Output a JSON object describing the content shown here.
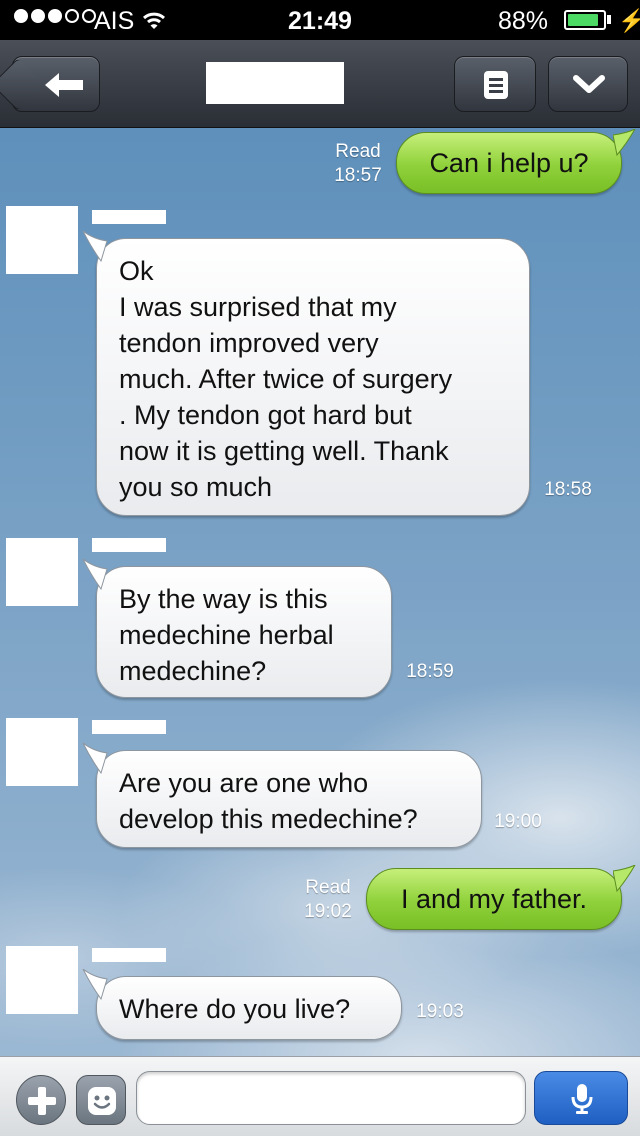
{
  "status_bar": {
    "carrier": "AIS",
    "time": "21:49",
    "battery_percent": "88%",
    "battery_level": 0.88,
    "signal_bars_filled": 3,
    "signal_bars_total": 5
  },
  "header": {
    "contact_name_redacted": true
  },
  "messages": [
    {
      "direction": "outgoing",
      "text": "Can i help u?",
      "status": "Read",
      "time": "18:57"
    },
    {
      "direction": "incoming",
      "text": "Ok\nI was surprised that my\ntendon improved very\nmuch. After twice of surgery\n. My tendon got hard but\nnow it is getting well. Thank\nyou so much",
      "time": "18:58"
    },
    {
      "direction": "incoming",
      "text": "By the way is this\nmedechine herbal\nmedechine?",
      "time": "18:59"
    },
    {
      "direction": "incoming",
      "text": "Are you are one who\ndevelop this medechine?",
      "time": "19:00"
    },
    {
      "direction": "outgoing",
      "text": "I and my father.",
      "status": "Read",
      "time": "19:02"
    },
    {
      "direction": "incoming",
      "text": "Where do you live?",
      "time": "19:03"
    }
  ],
  "composer": {
    "input_value": "",
    "input_placeholder": ""
  },
  "colors": {
    "outgoing_bubble": "#8fd13a",
    "incoming_bubble": "#ffffff",
    "header": "#2a2e35",
    "mic_button": "#1e5fc2",
    "battery_fill": "#4cd964"
  },
  "icons": [
    "back-arrow-icon",
    "menu-icon",
    "chevron-down-icon",
    "plus-icon",
    "emoji-icon",
    "microphone-icon",
    "wifi-icon",
    "battery-icon",
    "charging-icon"
  ]
}
